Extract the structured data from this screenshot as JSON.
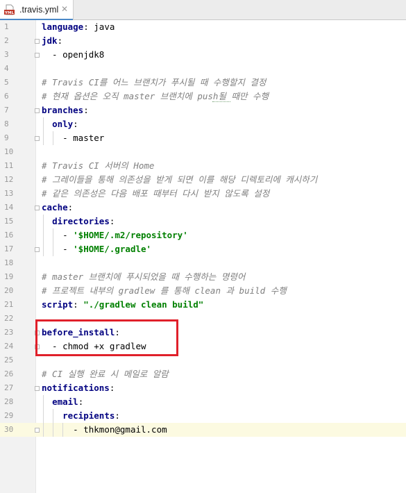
{
  "tab": {
    "icon_badge": "YML",
    "label": ".travis.yml",
    "close": "✕"
  },
  "lines": [
    {
      "n": "1",
      "key": "language",
      "sep": ": ",
      "val": "java"
    },
    {
      "n": "2",
      "key": "jdk",
      "sep": ":"
    },
    {
      "n": "3",
      "pre": "  - ",
      "val": "openjdk8"
    },
    {
      "n": "4"
    },
    {
      "n": "5",
      "cmt": "# Travis CI를 어느 브랜치가 푸시될 때 수행할지 결정"
    },
    {
      "n": "6",
      "cmt": "# 현재 옵션은 오직 master 브랜치에 push될 때만 수행"
    },
    {
      "n": "7",
      "key": "branches",
      "sep": ":"
    },
    {
      "n": "8",
      "pre": "  ",
      "key": "only",
      "sep": ":"
    },
    {
      "n": "9",
      "pre": "    - ",
      "val": "master"
    },
    {
      "n": "10"
    },
    {
      "n": "11",
      "cmt": "# Travis CI 서버의 Home"
    },
    {
      "n": "12",
      "cmt": "# 그레이들을 통해 의존성을 받게 되면 이를 해당 디렉토리에 캐시하기"
    },
    {
      "n": "13",
      "cmt": "# 같은 의존성은 다음 배포 때부터 다시 받지 않도록 설정"
    },
    {
      "n": "14",
      "key": "cache",
      "sep": ":"
    },
    {
      "n": "15",
      "pre": "  ",
      "key": "directories",
      "sep": ":"
    },
    {
      "n": "16",
      "pre": "    - ",
      "str": "'$HOME/.m2/repository'"
    },
    {
      "n": "17",
      "pre": "    - ",
      "str": "'$HOME/.gradle'"
    },
    {
      "n": "18"
    },
    {
      "n": "19",
      "cmt": "# master 브랜치에 푸시되었을 때 수행하는 명령어"
    },
    {
      "n": "20",
      "cmt": "# 프로젝트 내부의 gradlew 를 통해 clean 과 build 수행"
    },
    {
      "n": "21",
      "key": "script",
      "sep": ": ",
      "str": "\"./gradlew clean build\""
    },
    {
      "n": "22"
    },
    {
      "n": "23",
      "key": "before_install",
      "sep": ":"
    },
    {
      "n": "24",
      "pre": "  - ",
      "val": "chmod +x gradlew"
    },
    {
      "n": "25"
    },
    {
      "n": "26",
      "cmt": "# CI 실행 완료 시 메일로 알람"
    },
    {
      "n": "27",
      "key": "notifications",
      "sep": ":"
    },
    {
      "n": "28",
      "pre": "  ",
      "key": "email",
      "sep": ":"
    },
    {
      "n": "29",
      "pre": "    ",
      "key": "recipients",
      "sep": ":"
    },
    {
      "n": "30",
      "pre": "      - ",
      "val": "thkmon@gmail.com",
      "current": true
    }
  ]
}
